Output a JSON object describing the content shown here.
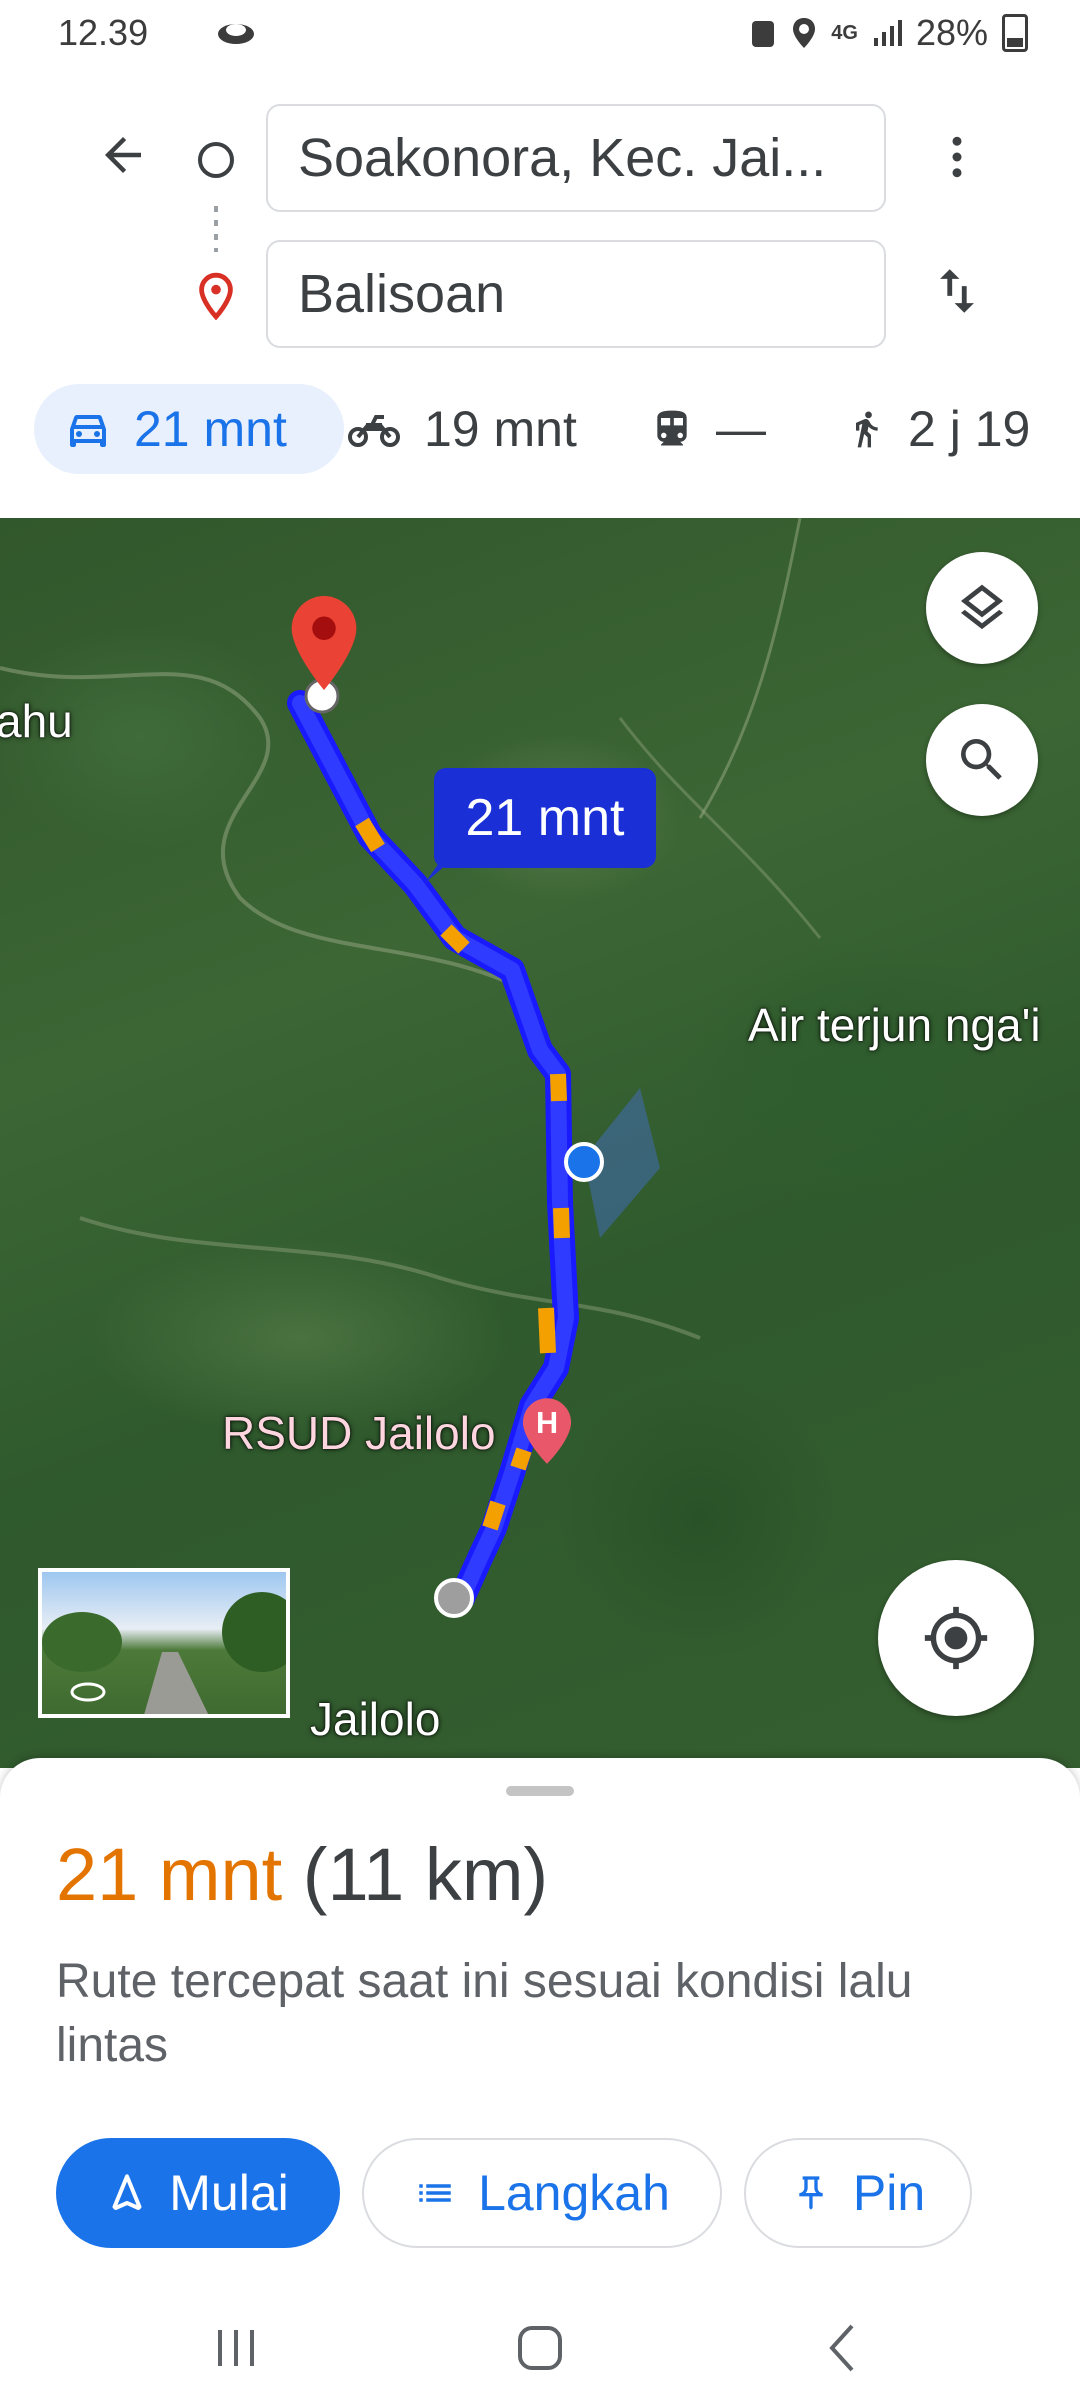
{
  "status_bar": {
    "time": "12.39",
    "network": "4G",
    "battery": "28%"
  },
  "directions": {
    "origin": "Soakonora, Kec. Jai...",
    "destination": "Balisoan"
  },
  "modes": [
    {
      "name": "car",
      "label": "21 mnt",
      "active": true
    },
    {
      "name": "motorbike",
      "label": "19 mnt",
      "active": false
    },
    {
      "name": "transit",
      "label": "—",
      "active": false
    },
    {
      "name": "walk",
      "label": "2 j 19",
      "active": false
    }
  ],
  "map": {
    "labels": {
      "left_partial": "ahu",
      "waterfall": "Air terjun nga'i",
      "hospital": "RSUD Jailolo",
      "town": "Jailolo"
    },
    "route_time_bubble": "21 mnt",
    "route_color": "#1a1aff",
    "traffic_color": "#f4a000"
  },
  "summary": {
    "duration": "21 mnt",
    "distance": "(11 km)",
    "description": "Rute tercepat saat ini sesuai kondisi lalu lintas"
  },
  "actions": {
    "start": "Mulai",
    "steps": "Langkah",
    "pin": "Pin"
  },
  "colors": {
    "accent": "#1a73e8",
    "duration_orange": "#e37400"
  }
}
